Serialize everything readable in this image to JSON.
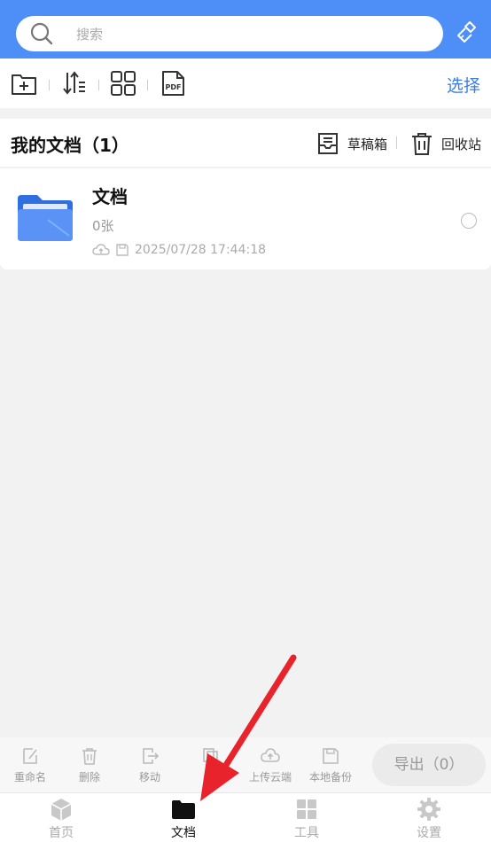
{
  "search": {
    "placeholder": "搜索"
  },
  "toolbar": {
    "select_label": "选择",
    "pdf_label": "PDF"
  },
  "section": {
    "title": "我的文档（1）",
    "drafts_label": "草稿箱",
    "trash_label": "回收站"
  },
  "document": {
    "name": "文档",
    "count": "0张",
    "timestamp": "2025/07/28 17:44:18"
  },
  "actions": {
    "rename": "重命名",
    "delete": "删除",
    "move": "移动",
    "upload": "上传云端",
    "backup": "本地备份",
    "export": "导出（0）"
  },
  "nav": {
    "home": "首页",
    "docs": "文档",
    "tools": "工具",
    "settings": "设置"
  },
  "colors": {
    "accent": "#4d8ef7",
    "link": "#3a7de8",
    "folder": "#3f7ff0",
    "annotation_arrow": "#e8232b"
  }
}
